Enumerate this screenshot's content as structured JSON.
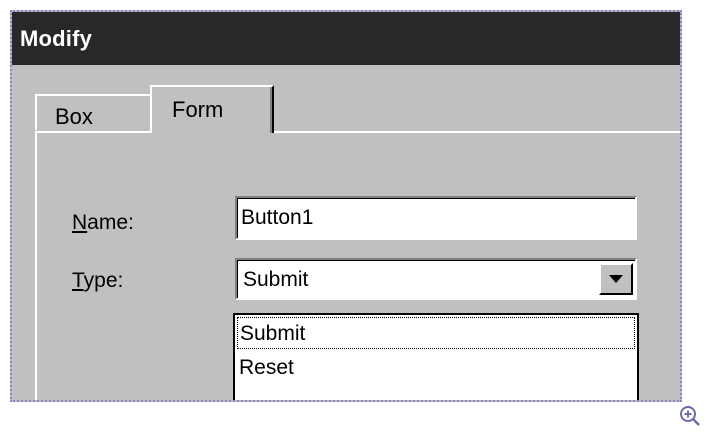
{
  "dialog": {
    "title": "Modify",
    "tabs": [
      {
        "label": "Box",
        "active": false
      },
      {
        "label": "Form",
        "active": true
      }
    ],
    "name_field": {
      "label_mnemonic": "N",
      "label_rest": "ame:",
      "value": "Button1"
    },
    "type_field": {
      "label_mnemonic": "T",
      "label_rest": "ype:",
      "selected": "Submit",
      "options": [
        "Submit",
        "Reset"
      ]
    }
  },
  "icons": {
    "dropdown_arrow": "chevron-down-icon",
    "zoom": "zoom-in-icon"
  },
  "colors": {
    "titlebar": "#282828",
    "dialog_bg": "#c0c0c0",
    "frame_border": "#8a86c2",
    "zoom_icon": "#6b6bb0"
  }
}
